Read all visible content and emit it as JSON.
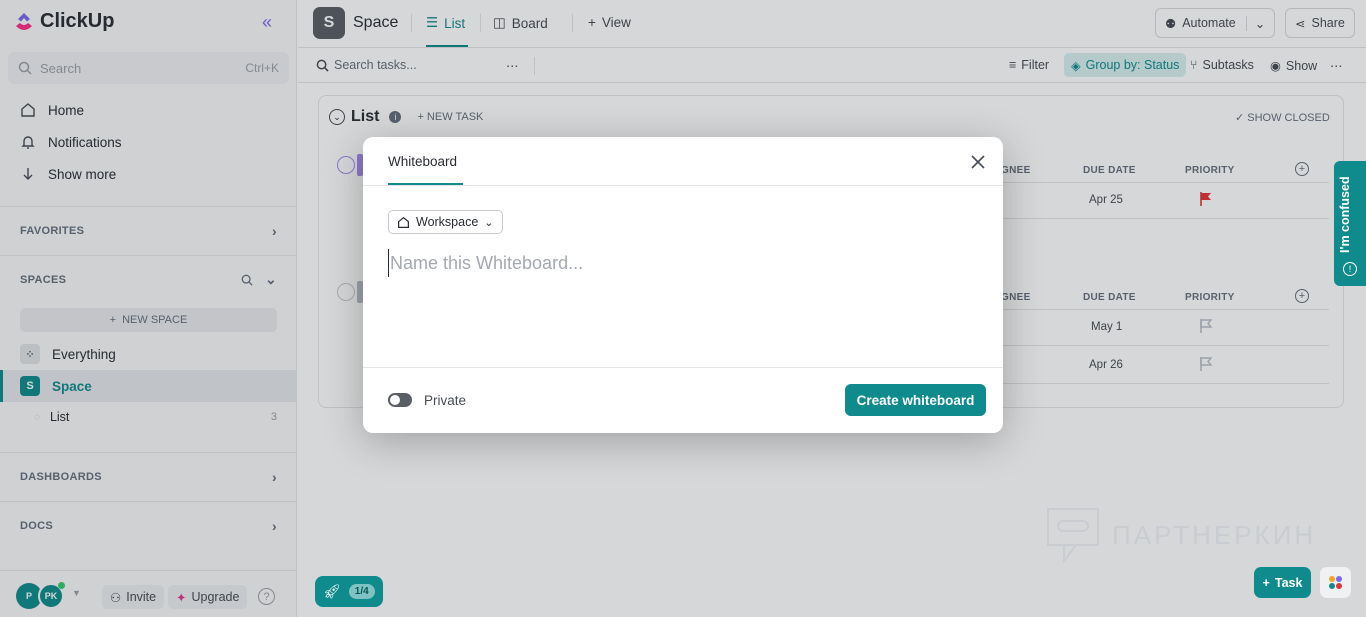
{
  "app": {
    "name": "ClickUp"
  },
  "sidebar": {
    "search_placeholder": "Search",
    "search_shortcut": "Ctrl+K",
    "nav": [
      {
        "label": "Home",
        "icon": "home-icon"
      },
      {
        "label": "Notifications",
        "icon": "bell-icon"
      },
      {
        "label": "Show more",
        "icon": "arrow-down-icon"
      }
    ],
    "favorites_label": "FAVORITES",
    "spaces_label": "SPACES",
    "new_space_label": "NEW SPACE",
    "everything_label": "Everything",
    "space_name": "Space",
    "space_initial": "S",
    "list_name": "List",
    "list_count": "3",
    "dashboards_label": "DASHBOARDS",
    "docs_label": "DOCS",
    "avatar_1": "P",
    "avatar_2": "PK",
    "invite_label": "Invite",
    "upgrade_label": "Upgrade",
    "help_label": "?"
  },
  "topbar": {
    "space_initial": "S",
    "space_title": "Space",
    "tabs": [
      {
        "label": "List",
        "icon": "list-icon",
        "active": true
      },
      {
        "label": "Board",
        "icon": "board-icon",
        "active": false
      },
      {
        "label": "View",
        "icon": "plus-icon",
        "active": false
      }
    ],
    "automate_label": "Automate",
    "share_label": "Share"
  },
  "toolbar": {
    "search_placeholder": "Search tasks...",
    "more": "⋯",
    "filter_label": "Filter",
    "groupby_label": "Group by: Status",
    "subtasks_label": "Subtasks",
    "show_label": "Show",
    "menu": "⋯"
  },
  "list": {
    "title": "List",
    "new_task_label": "+ NEW TASK",
    "show_closed_label": "SHOW CLOSED",
    "groups": [
      {
        "headers": {
          "assignee": "GNEE",
          "due": "DUE DATE",
          "priority": "PRIORITY"
        },
        "rows": [
          {
            "due": "Apr 25",
            "priority_color": "#e5323a",
            "flag": "filled"
          }
        ]
      },
      {
        "headers": {
          "assignee": "GNEE",
          "due": "DUE DATE",
          "priority": "PRIORITY"
        },
        "rows": [
          {
            "due": "May 1",
            "priority_color": "#b9bec7",
            "flag": "outline"
          },
          {
            "due": "Apr 26",
            "priority_color": "#b9bec7",
            "flag": "outline"
          }
        ]
      }
    ]
  },
  "modal": {
    "tab_label": "Whiteboard",
    "workspace_label": "Workspace",
    "name_placeholder": "Name this Whiteboard...",
    "private_label": "Private",
    "create_label": "Create whiteboard"
  },
  "widgets": {
    "confused_label": "I'm confused",
    "onboarding_count": "1/4",
    "task_label": "Task",
    "watermark_text": "ПАРТНЕРКИН"
  },
  "colors": {
    "accent": "#0f8b8d",
    "brand_purple": "#7b68ee"
  }
}
